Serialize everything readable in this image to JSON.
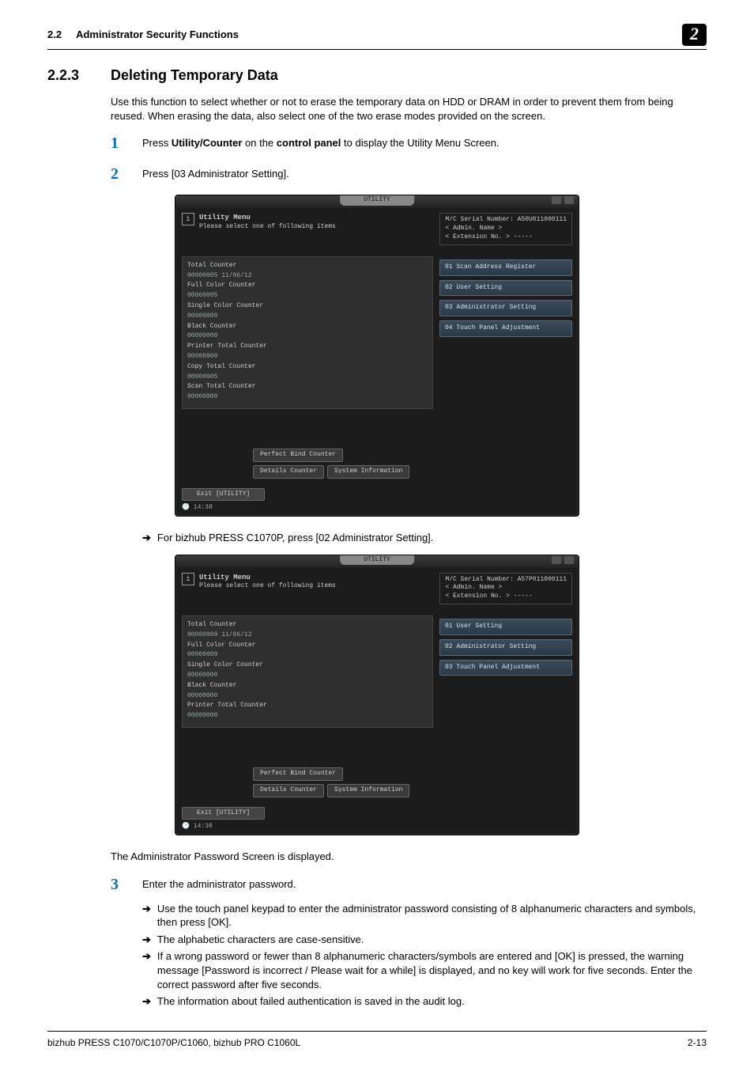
{
  "header": {
    "section_num": "2.2",
    "section_title": "Administrator Security Functions",
    "chapter_badge": "2"
  },
  "section": {
    "num": "2.2.3",
    "title": "Deleting Temporary Data",
    "intro": "Use this function to select whether or not to erase the temporary data on HDD or DRAM in order to prevent them from being reused. When erasing the data, also select one of the two erase modes provided on the screen."
  },
  "steps": {
    "s1": {
      "num": "1",
      "pre": "Press ",
      "b1": "Utility/Counter",
      "mid": " on the ",
      "b2": "control panel",
      "post": " to display the Utility Menu Screen."
    },
    "s2": {
      "num": "2",
      "text": "Press [03 Administrator Setting]."
    },
    "note_after_img1": "For bizhub PRESS C1070P, press [02 Administrator Setting].",
    "after_img2": "The Administrator Password Screen is displayed.",
    "s3": {
      "num": "3",
      "text": "Enter the administrator password.",
      "bullets": [
        "Use the touch panel keypad to enter the administrator password consisting of 8 alphanumeric characters and symbols, then press [OK].",
        "The alphabetic characters are case-sensitive.",
        "If a wrong password or fewer than 8 alphanumeric characters/symbols are entered and [OK] is pressed, the warning message [Password is incorrect / Please wait for a while] is displayed, and no key will work for five seconds. Enter the correct password after five seconds.",
        "The information about failed authentication is saved in the audit log."
      ]
    }
  },
  "ui1": {
    "tab": "UTILITY",
    "menu_title": "Utility Menu",
    "menu_sub": "Please select one of following items",
    "serial_label": "M/C Serial Number:",
    "serial": "A50U011000111",
    "admin_label": "< Admin. Name >",
    "ext_label": "< Extension No. >  -----",
    "counters": [
      {
        "label": "Total Counter",
        "value": "00000005   11/06/12"
      },
      {
        "label": "Full Color Counter",
        "value": "00000005"
      },
      {
        "label": "Single Color Counter",
        "value": "00000000"
      },
      {
        "label": "Black Counter",
        "value": "00000000"
      },
      {
        "label": "Printer Total Counter",
        "value": "00000000"
      },
      {
        "label": "Copy Total Counter",
        "value": "00000005"
      },
      {
        "label": "Scan Total Counter",
        "value": "00000000"
      }
    ],
    "mid_buttons": {
      "perfect": "Perfect Bind Counter",
      "details": "Details Counter",
      "sysinfo": "System Information"
    },
    "options": [
      "01 Scan Address Register",
      "02 User Setting",
      "03 Administrator Setting",
      "04 Touch Panel Adjustment"
    ],
    "exit": "Exit [UTILITY]",
    "clock": "14:38"
  },
  "ui2": {
    "tab": "UTILITY",
    "menu_title": "Utility Menu",
    "menu_sub": "Please select one of following items",
    "serial_label": "M/C Serial Number:",
    "serial": "A57P011000111",
    "admin_label": "< Admin. Name >",
    "ext_label": "< Extension No. >  -----",
    "counters": [
      {
        "label": "Total Counter",
        "value": "00000009   11/06/12"
      },
      {
        "label": "Full Color Counter",
        "value": "00000009"
      },
      {
        "label": "Single Color Counter",
        "value": "00000000"
      },
      {
        "label": "Black Counter",
        "value": "00000000"
      },
      {
        "label": "Printer Total Counter",
        "value": "00000000"
      }
    ],
    "mid_buttons": {
      "perfect": "Perfect Bind Counter",
      "details": "Details Counter",
      "sysinfo": "System Information"
    },
    "options": [
      "01 User Setting",
      "02 Administrator Setting",
      "03 Touch Panel Adjustment"
    ],
    "exit": "Exit [UTILITY]",
    "clock": "14:38"
  },
  "footer": {
    "left": "bizhub PRESS C1070/C1070P/C1060, bizhub PRO C1060L",
    "right": "2-13"
  }
}
